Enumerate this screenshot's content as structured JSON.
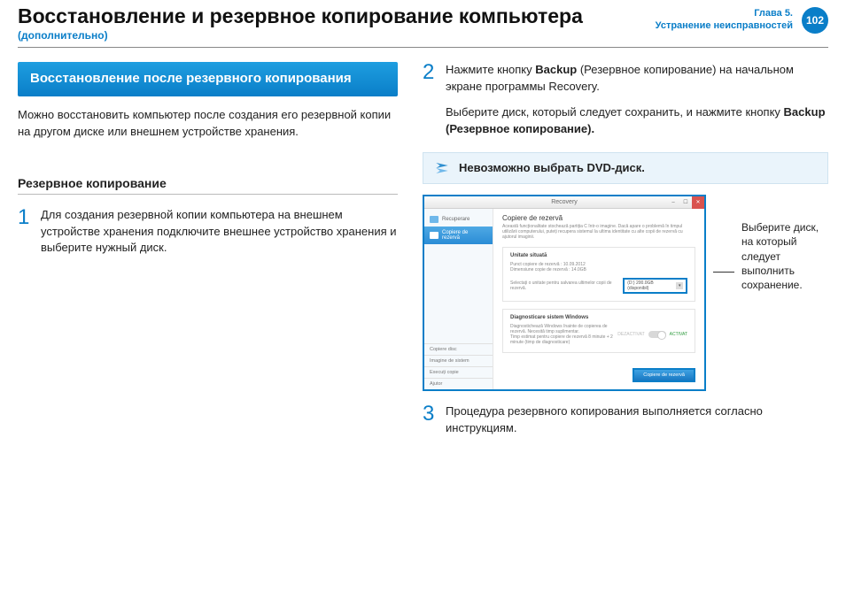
{
  "header": {
    "title": "Восстановление и резервное копирование компьютера",
    "subtitle": "(дополнительно)",
    "chapter_line1": "Глава 5.",
    "chapter_line2": "Устранение неисправностей",
    "page_number": "102"
  },
  "left": {
    "banner": "Восстановление после резервного копирования",
    "intro": "Можно восстановить компьютер после создания его резервной копии на другом диске или внешнем устройстве хранения.",
    "subhead": "Резервное копирование",
    "step1_num": "1",
    "step1_text": "Для создания резервной копии компьютера на внешнем устройстве хранения подключите внешнее устройство хранения и выберите нужный диск."
  },
  "right": {
    "step2_num": "2",
    "step2_prefix": "Нажмите кнопку ",
    "step2_bold1": "Backup",
    "step2_mid": " (Резервное копирование) на начальном экране программы Recovery.",
    "step2_sub_prefix": "Выберите диск, который следует сохранить, и нажмите кнопку ",
    "step2_sub_bold": "Backup (Резервное копирование).",
    "note": "Невозможно выбрать DVD-диск.",
    "screenshot": {
      "win_title": "Recovery",
      "nav_item1": "Recuperare",
      "nav_item2": "Copiere de rezervă",
      "sb_copy": "Copiere disc",
      "sb_image": "Imagine de sistem",
      "sb_exec": "Execuți copie",
      "sb_help": "Ajutor",
      "main_title": "Copiere de rezervă",
      "main_desc": "Această funcționalitate stochează partiția C într-o imagine. Dacă apare o problemă în timpul utilizării computerului, puteți recupera sistemul la ultima identitate cu alte copii de rezervă cu ajutorul imaginii.",
      "panel1_title": "Unitate situată",
      "panel1_line1": "Punct copiere de rezervă : 10.09.2012",
      "panel1_line2": "Dimensiune copie de rezervă : 14.0GB",
      "panel1_line3": "Selectați o unitate pentru salvarea ultimelor copii de rezervă.",
      "disk_label": "(D:) 200.0GB (disponibil)",
      "panel2_title": "Diagnosticare sistem Windows",
      "panel2_line1": "Diagnostichează Windows înainte de copierea de rezervă. Necesită timp suplimentar.",
      "panel2_line2": "Timp estimat pentru copiere de rezervă 8 minute + 2 minute (timp de diagnosticare)",
      "toggle_off": "DEZACTIVAT",
      "toggle_on": "ACTIVAT",
      "backup_btn": "Copiere de rezervă"
    },
    "callout": "Выберите диск, на который следует выполнить сохранение.",
    "step3_num": "3",
    "step3_text": "Процедура резервного копирования выполняется согласно инструкциям."
  }
}
